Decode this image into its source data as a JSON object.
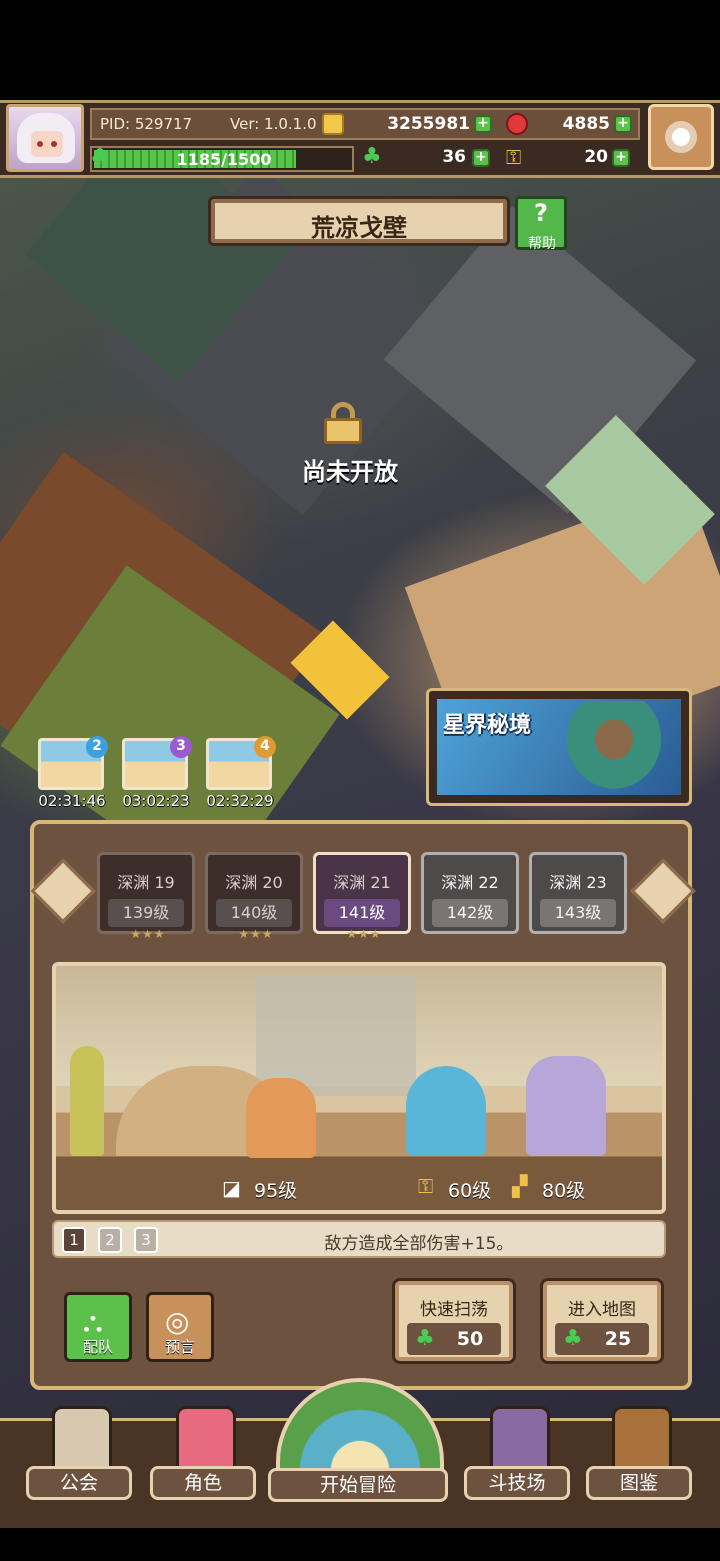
{
  "player": {
    "pid": "PID: 529717",
    "version": "Ver: 1.0.1.0",
    "gold": "3255981",
    "gems": "4885",
    "xp": "1185/1500",
    "xp_fraction": 0.79,
    "clover": "36",
    "keys": "20"
  },
  "zone": {
    "title": "荒凉戈壁",
    "help_label": "帮助",
    "help_glyph": "?"
  },
  "locked": {
    "text": "尚未开放"
  },
  "astral": {
    "title": "星界秘境"
  },
  "chests": [
    {
      "badge": "2",
      "time": "02:31:46",
      "color": "#3aa0e0"
    },
    {
      "badge": "3",
      "time": "03:02:23",
      "color": "#9b5ad0"
    },
    {
      "badge": "4",
      "time": "02:32:29",
      "color": "#e09a30"
    }
  ],
  "stages": [
    {
      "name": "深渊 19",
      "level": "139级",
      "stars": "★★★"
    },
    {
      "name": "深渊 20",
      "level": "140级",
      "stars": "★★★"
    },
    {
      "name": "深渊 21",
      "level": "141级",
      "stars": "★★★"
    },
    {
      "name": "深渊 22",
      "level": "142级",
      "stars": ""
    },
    {
      "name": "深渊 23",
      "level": "143级",
      "stars": ""
    }
  ],
  "scene": {
    "power_level": "95级",
    "key_level": "60级",
    "boot_level": "80级"
  },
  "tip": {
    "pages": [
      "1",
      "2",
      "3"
    ],
    "text": "敌方造成全部伤害+15。"
  },
  "actions": {
    "team": "配队",
    "prophecy": "预言",
    "sweep_label": "快速扫荡",
    "sweep_cost": "50",
    "enter_label": "进入地图",
    "enter_cost": "25"
  },
  "nav": {
    "guild": "公会",
    "character": "角色",
    "adventure": "开始冒险",
    "arena": "斗技场",
    "codex": "图鉴"
  }
}
